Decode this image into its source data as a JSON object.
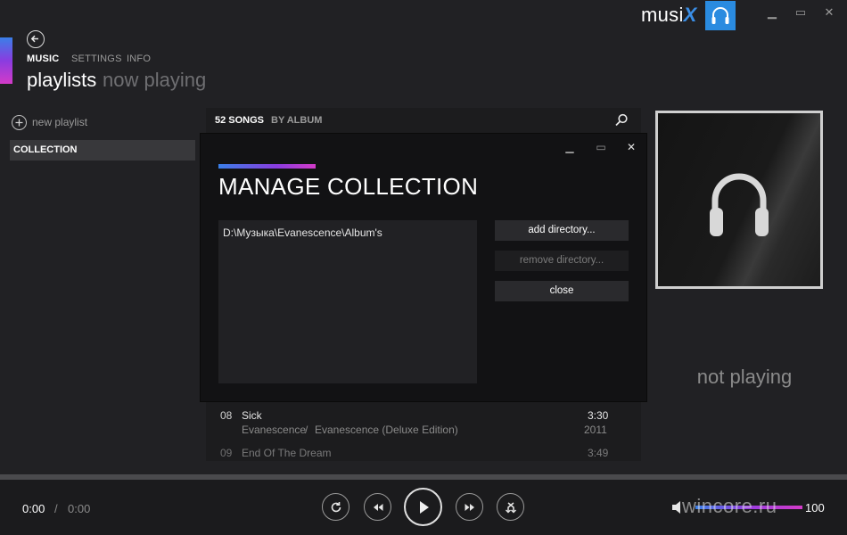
{
  "app": {
    "brand_name": "musi",
    "brand_suffix": "X",
    "window_controls": [
      "minimize",
      "maximize",
      "close"
    ]
  },
  "nav": {
    "pivots": [
      {
        "label": "MUSIC",
        "active": true
      },
      {
        "label": "SETTINGS",
        "active": false
      },
      {
        "label": "INFO",
        "active": false
      }
    ],
    "title": "playlists",
    "subtitle": "now playing"
  },
  "sidebar": {
    "new_playlist_label": "new playlist",
    "items": [
      {
        "label": "COLLECTION",
        "selected": true
      }
    ]
  },
  "songlist": {
    "count_label": "52 SONGS",
    "sort_label": "BY ALBUM",
    "songs": [
      {
        "num": "08",
        "title": "Sick",
        "artist": "Evanescence",
        "album": "Evanescence (Deluxe Edition)",
        "duration": "3:30",
        "year": "2011"
      },
      {
        "num": "09",
        "title": "End Of The Dream",
        "duration": "3:49"
      }
    ]
  },
  "now_playing": {
    "status": "not playing"
  },
  "modal": {
    "title": "MANAGE COLLECTION",
    "directories": [
      "D:\\Музыка\\Evanescence\\Album's"
    ],
    "add_label": "add directory...",
    "remove_label": "remove directory...",
    "close_label": "close"
  },
  "player": {
    "current_time": "0:00",
    "separator": "/",
    "total_time": "0:00",
    "volume": 100,
    "volume_label": "100",
    "progress": 0
  },
  "watermark": "wincore.ru",
  "colors": {
    "accent_blue": "#2a8be0",
    "accent_purple": "#8a3ce0",
    "accent_pink": "#d33bc8",
    "background": "#212124"
  }
}
